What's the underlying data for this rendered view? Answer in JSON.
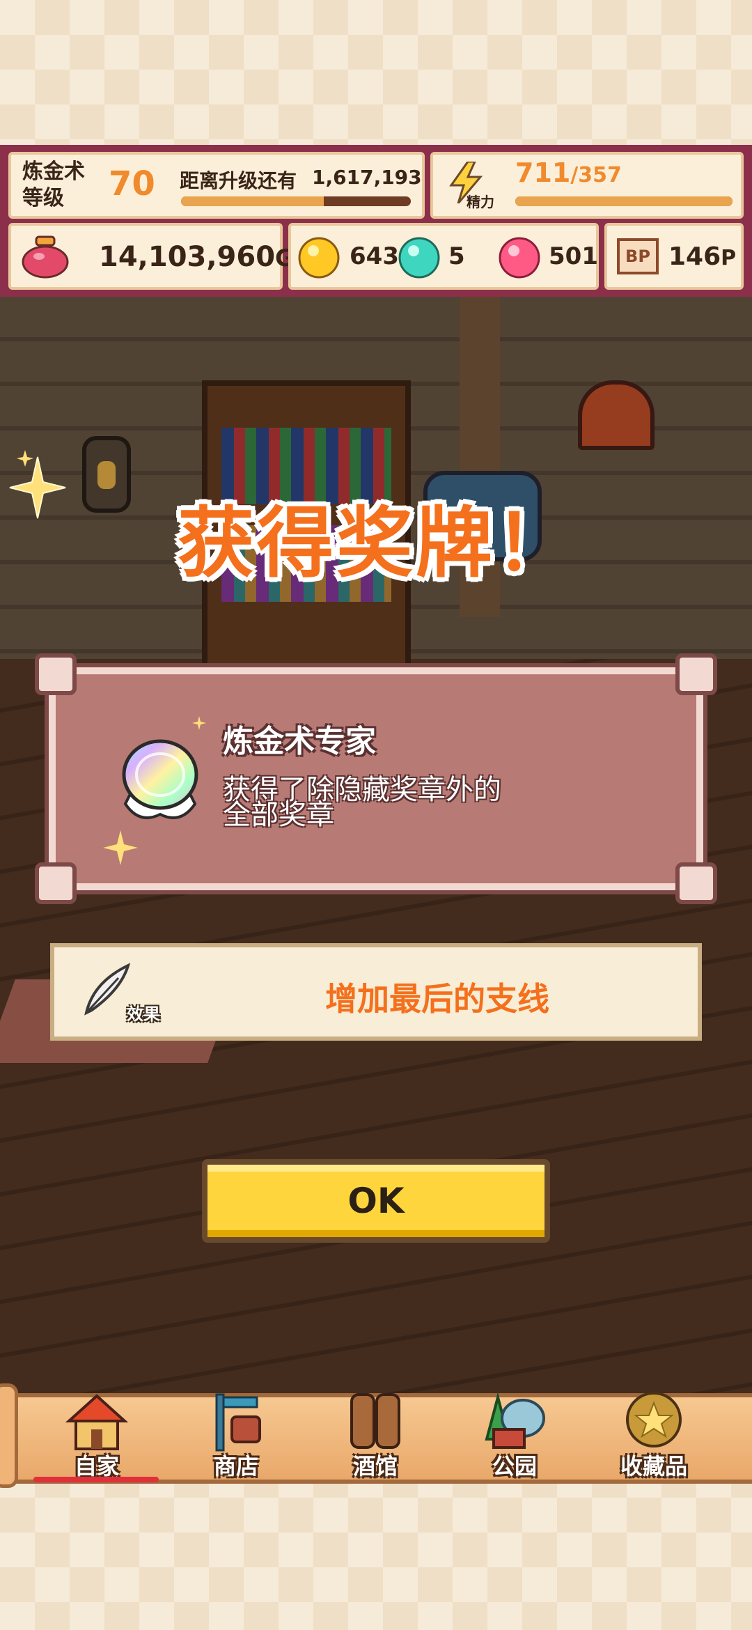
{
  "hud": {
    "alchemy_label_line1": "炼金术",
    "alchemy_label_line2": "等级",
    "alchemy_level": "70",
    "next_level_label": "距离升级还有",
    "next_level_value": "1,617,193",
    "level_progress": 0.62,
    "energy_current": "711",
    "energy_max": "/357",
    "energy_label": "精力",
    "energy_progress": 1.0,
    "gold": "14,103,960",
    "gold_unit": "G",
    "gem_yellow": "643",
    "gem_teal": "5",
    "gem_pink": "501",
    "bp_badge": "BP",
    "bp_value": "146",
    "bp_unit": "P"
  },
  "popup": {
    "title": "获得奖牌！",
    "medal_name": "炼金术专家",
    "medal_desc_line1": "获得了除隐藏奖章外的",
    "medal_desc_line2": "全部奖章",
    "effect_label": "效果",
    "effect_text": "增加最后的支线",
    "ok_label": "OK"
  },
  "nav": {
    "items": [
      {
        "label": "自家"
      },
      {
        "label": "商店"
      },
      {
        "label": "酒馆"
      },
      {
        "label": "公园"
      },
      {
        "label": "收藏品"
      }
    ]
  },
  "colors": {
    "hud_bg": "#8c2f4a",
    "accent_orange": "#f4701c",
    "ok_yellow": "#ffd53d",
    "medal_card": "#b87a74"
  }
}
